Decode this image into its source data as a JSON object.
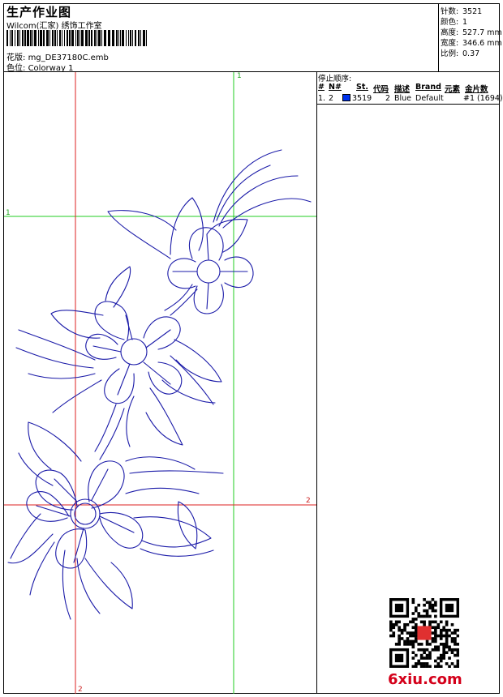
{
  "header": {
    "title": "生产作业图",
    "company": "Wilcom(汇家) 绣饰工作室",
    "design_label": "花版:",
    "design_value": "mg_DE37180C.emb",
    "color_label": "色位:",
    "color_value": "Colorway 1"
  },
  "stats": [
    {
      "label": "针数:",
      "value": "3521"
    },
    {
      "label": "颜色:",
      "value": "1"
    },
    {
      "label": "高度:",
      "value": "527.7 mm"
    },
    {
      "label": "宽度:",
      "value": "346.6 mm"
    },
    {
      "label": "比例:",
      "value": "0.37"
    }
  ],
  "stop_sequence": {
    "title": "停止顺序:",
    "headers": {
      "idx": "#",
      "needle": "N#",
      "st": "St.",
      "code": "代码",
      "desc": "描述",
      "brand": "Brand",
      "element": "元素",
      "metallic": "金片数"
    },
    "rows": [
      {
        "idx": "1.",
        "needle": "2",
        "st": "3519",
        "code": "2",
        "desc": "Blue",
        "brand": "Default",
        "element": "#1 (1694)",
        "color": "#0033ee"
      }
    ]
  },
  "guides": {
    "v1": "1",
    "h1": "1",
    "h2": "2",
    "v2": "2"
  },
  "thread_color": "#1a1aa8",
  "watermark": "6xiu.com"
}
